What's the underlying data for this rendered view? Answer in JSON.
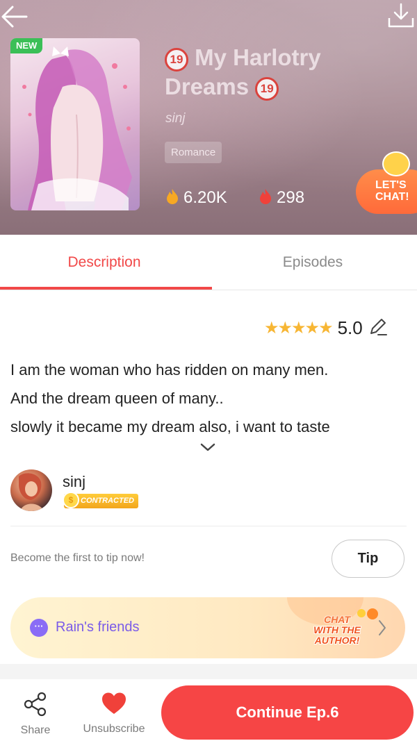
{
  "header": {
    "new_badge": "NEW",
    "age_badge": "19",
    "title_line1": "My Harlotry",
    "title_line2": "Dreams",
    "author": "sinj",
    "genre": "Romance",
    "views": "6.20K",
    "likes": "298",
    "chat_line1": "LET'S",
    "chat_line2": "CHAT!"
  },
  "tabs": [
    {
      "label": "Description",
      "active": true
    },
    {
      "label": "Episodes",
      "active": false
    }
  ],
  "rating": {
    "stars": "★★★★★",
    "value": "5.0"
  },
  "description": {
    "line1": "I am the woman who has ridden on many men.",
    "line2": "And the dream queen of many..",
    "line3": "slowly it became my dream also, i want to taste"
  },
  "author_card": {
    "name": "sinj",
    "badge": "CONTRACTED",
    "badge_icon": "$"
  },
  "tip": {
    "prompt": "Become the first to tip now!",
    "button": "Tip"
  },
  "friends": {
    "label": "Rain's friends",
    "icon_text": "···",
    "chat_line1": "CHAT",
    "chat_line2": "WITH THE",
    "chat_line3": "AUTHOR!"
  },
  "bottom_bar": {
    "share": "Share",
    "unsubscribe": "Unsubscribe",
    "continue": "Continue Ep.6"
  },
  "colors": {
    "accent": "#f14848",
    "star": "#f7b634",
    "purple": "#7a5be8",
    "continue_bg": "#f64545"
  }
}
